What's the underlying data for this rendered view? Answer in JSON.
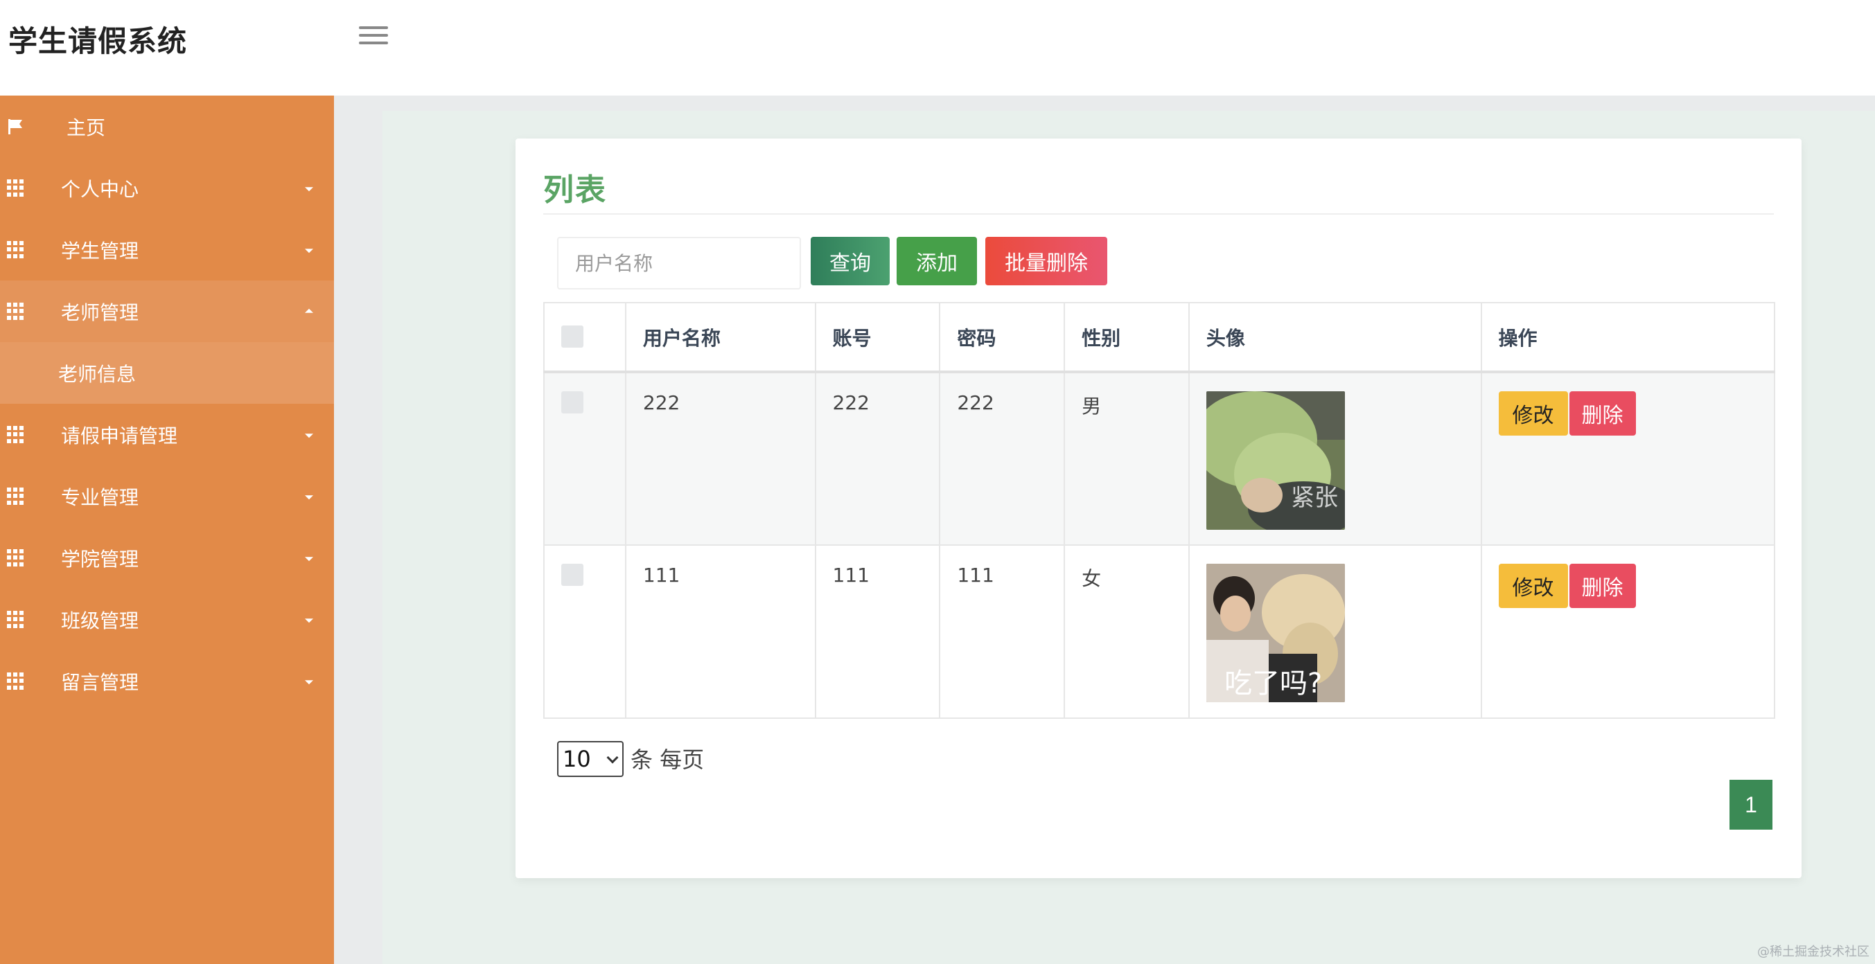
{
  "header": {
    "title": "学生请假系统"
  },
  "sidebar": {
    "items": [
      {
        "label": "主页",
        "icon": "flag-icon"
      },
      {
        "label": "个人中心",
        "icon": "grid-icon"
      },
      {
        "label": "学生管理",
        "icon": "grid-icon"
      },
      {
        "label": "老师管理",
        "icon": "grid-icon",
        "expanded": true
      },
      {
        "label": "请假申请管理",
        "icon": "grid-icon"
      },
      {
        "label": "专业管理",
        "icon": "grid-icon"
      },
      {
        "label": "学院管理",
        "icon": "grid-icon"
      },
      {
        "label": "班级管理",
        "icon": "grid-icon"
      },
      {
        "label": "留言管理",
        "icon": "grid-icon"
      }
    ],
    "sub_item": "老师信息"
  },
  "card": {
    "title": "列表"
  },
  "toolbar": {
    "search_placeholder": "用户名称",
    "query_label": "查询",
    "add_label": "添加",
    "batch_delete_label": "批量删除"
  },
  "table": {
    "headers": [
      "用户名称",
      "账号",
      "密码",
      "性别",
      "头像",
      "操作"
    ],
    "rows": [
      {
        "username": "222",
        "account": "222",
        "password": "222",
        "gender": "男",
        "avatar_caption": "紧张"
      },
      {
        "username": "111",
        "account": "111",
        "password": "111",
        "gender": "女",
        "avatar_caption": "吃了吗?"
      }
    ],
    "edit_label": "修改",
    "delete_label": "删除"
  },
  "pagination": {
    "page_size": "10",
    "per_page_text": "条 每页",
    "current_page": "1"
  },
  "watermark": "@稀土掘金技术社区",
  "colors": {
    "sidebar": "#e28a48",
    "title_green": "#5aa464",
    "query": "#2f7e5a",
    "add": "#46a049",
    "batch_delete": "#eb4b3c",
    "edit": "#f5bd3b",
    "delete": "#e94d60",
    "page_active": "#3b8a55"
  }
}
